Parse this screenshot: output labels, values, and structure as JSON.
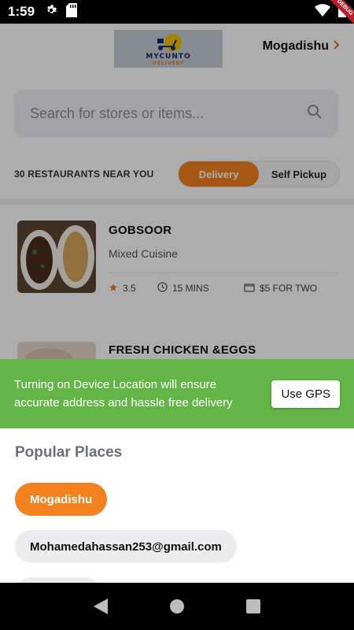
{
  "status_bar": {
    "time": "1:59",
    "icons": [
      "settings-icon",
      "sd-card-icon",
      "wifi-icon",
      "battery-icon"
    ],
    "ribbon": "DEBUG"
  },
  "header": {
    "logo_text": "MYCUNTO",
    "logo_subtext": "DELIVERY",
    "city": "Mogadishu"
  },
  "search": {
    "placeholder": "Search for stores or items..."
  },
  "filters": {
    "near_label": "30 RESTAURANTS NEAR YOU",
    "options": [
      "Delivery",
      "Self Pickup"
    ],
    "selected": "Delivery"
  },
  "stores": [
    {
      "name": "GOBSOOR",
      "cuisine": "Mixed Cuisine",
      "rating": "3.5",
      "time": "15 MINS",
      "cost": "$5 FOR TWO"
    },
    {
      "name": "FRESH CHICKEN &EGGS"
    }
  ],
  "gps_banner": {
    "text": "Turning on Device Location will ensure accurate address and hassle free delivery",
    "button": "Use GPS"
  },
  "popular": {
    "title": "Popular Places",
    "places": [
      "Mogadishu",
      "Mohamedahassan253@gmail.com"
    ],
    "selected": "Mogadishu"
  },
  "colors": {
    "accent": "#f3811d",
    "gps_green": "#64b548",
    "title_gray": "#6a7078"
  }
}
